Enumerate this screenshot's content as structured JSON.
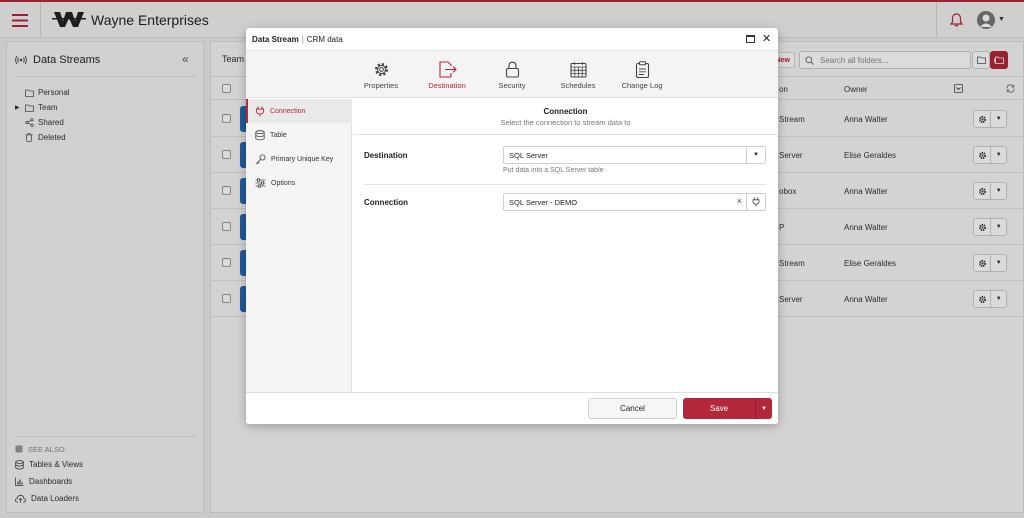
{
  "app": {
    "brand": "Wayne Enterprises"
  },
  "sidebar": {
    "title": "Data Streams",
    "tree": [
      {
        "label": "Personal"
      },
      {
        "label": "Team"
      },
      {
        "label": "Shared"
      },
      {
        "label": "Deleted"
      }
    ],
    "see_also": {
      "heading": "SEE ALSO",
      "items": [
        {
          "label": "Tables & Views"
        },
        {
          "label": "Dashboards"
        },
        {
          "label": "Data Loaders"
        }
      ]
    }
  },
  "main": {
    "breadcrumb": "Team",
    "new_label": "New",
    "search_placeholder": "Search all folders...",
    "columns": {
      "destination_partial": "on",
      "owner": "Owner"
    },
    "rows": [
      {
        "destination": "Stream",
        "owner": "Anna Walter"
      },
      {
        "destination": "Server",
        "owner": "Elise Geraldes"
      },
      {
        "destination": "obox",
        "owner": "Anna Walter"
      },
      {
        "destination": "P",
        "owner": "Anna Walter"
      },
      {
        "destination": "Stream",
        "owner": "Elise Geraldes"
      },
      {
        "destination": "Server",
        "owner": "Anna Walter"
      }
    ]
  },
  "modal": {
    "title": "Data Stream",
    "subtitle": "CRM data",
    "tabs": [
      {
        "label": "Properties",
        "icon": "gear-icon"
      },
      {
        "label": "Destination",
        "icon": "export-icon",
        "active": true
      },
      {
        "label": "Security",
        "icon": "lock-icon"
      },
      {
        "label": "Schedules",
        "icon": "calendar-icon"
      },
      {
        "label": "Change Log",
        "icon": "clipboard-icon"
      }
    ],
    "nav": [
      {
        "label": "Connection",
        "icon": "plug-icon",
        "active": true
      },
      {
        "label": "Table",
        "icon": "database-icon"
      },
      {
        "label": "Primary Unique Key",
        "icon": "key-icon"
      },
      {
        "label": "Options",
        "icon": "sliders-icon"
      }
    ],
    "section": {
      "title": "Connection",
      "subtitle": "Select the connection to stream data to"
    },
    "fields": {
      "destination": {
        "label": "Destination",
        "value": "SQL Server",
        "help": "Put data into a SQL Server table"
      },
      "connection": {
        "label": "Connection",
        "value": "SQL Server - DEMO"
      }
    },
    "footer": {
      "cancel": "Cancel",
      "save": "Save"
    }
  },
  "colors": {
    "accent": "#b2283a",
    "row_icon": "#2868b4"
  }
}
